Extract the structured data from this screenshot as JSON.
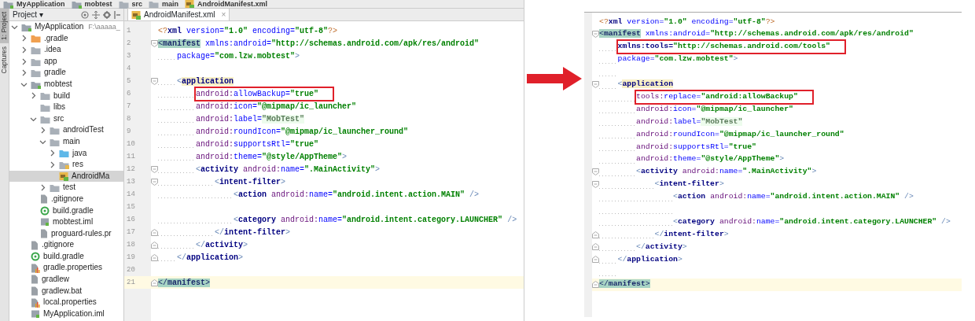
{
  "breadcrumbs": [
    {
      "label": "MyApplication",
      "kind": "module"
    },
    {
      "label": "mobtest",
      "kind": "module"
    },
    {
      "label": "src",
      "kind": "folder"
    },
    {
      "label": "main",
      "kind": "folder"
    },
    {
      "label": "AndroidManifest.xml",
      "kind": "manifest"
    }
  ],
  "tool_strip": [
    {
      "label": "1: Project",
      "selected": true
    },
    {
      "label": "Captures",
      "selected": false
    }
  ],
  "project_panel": {
    "title": "Project ▾",
    "tree": [
      {
        "label": "MyApplication",
        "path": "F:\\aaaaa_",
        "kind": "module",
        "expanded": true,
        "selected": false,
        "children": [
          {
            "label": ".gradle",
            "kind": "excluded",
            "expanded": false,
            "selected": false
          },
          {
            "label": ".idea",
            "kind": "folder",
            "expanded": false,
            "selected": false
          },
          {
            "label": "app",
            "kind": "folder",
            "expanded": false,
            "selected": false
          },
          {
            "label": "gradle",
            "kind": "folder",
            "expanded": false,
            "selected": false
          },
          {
            "label": "mobtest",
            "kind": "module",
            "expanded": true,
            "selected": false,
            "children": [
              {
                "label": "build",
                "kind": "folder",
                "expanded": false,
                "selected": false
              },
              {
                "label": "libs",
                "kind": "folder",
                "selected": false
              },
              {
                "label": "src",
                "kind": "folder",
                "expanded": true,
                "selected": false,
                "children": [
                  {
                    "label": "androidTest",
                    "kind": "folder",
                    "expanded": false,
                    "selected": false
                  },
                  {
                    "label": "main",
                    "kind": "folder",
                    "expanded": true,
                    "selected": false,
                    "children": [
                      {
                        "label": "java",
                        "kind": "source",
                        "expanded": false,
                        "selected": false
                      },
                      {
                        "label": "res",
                        "kind": "resource",
                        "expanded": false,
                        "selected": false
                      },
                      {
                        "label": "AndroidMa",
                        "kind": "manifest",
                        "selected": true
                      }
                    ]
                  },
                  {
                    "label": "test",
                    "kind": "folder",
                    "expanded": false,
                    "selected": false
                  }
                ]
              },
              {
                "label": ".gitignore",
                "kind": "file",
                "selected": false
              },
              {
                "label": "build.gradle",
                "kind": "gradle",
                "selected": false
              },
              {
                "label": "mobtest.iml",
                "kind": "iml",
                "selected": false
              },
              {
                "label": "proguard-rules.pr",
                "kind": "file",
                "selected": false
              }
            ]
          },
          {
            "label": ".gitignore",
            "kind": "file",
            "selected": false
          },
          {
            "label": "build.gradle",
            "kind": "gradle",
            "selected": false
          },
          {
            "label": "gradle.properties",
            "kind": "properties",
            "selected": false
          },
          {
            "label": "gradlew",
            "kind": "file",
            "selected": false
          },
          {
            "label": "gradlew.bat",
            "kind": "file",
            "selected": false
          },
          {
            "label": "local.properties",
            "kind": "properties",
            "selected": false
          },
          {
            "label": "MyApplication.iml",
            "kind": "iml",
            "selected": false
          }
        ]
      }
    ]
  },
  "editor_tab": {
    "label": "AndroidManifest.xml",
    "close": "×",
    "selected": true
  },
  "left_editor": {
    "lines": [
      {
        "number": "1",
        "tokens": [
          {
            "kind": "decl",
            "text": "<?"
          },
          {
            "kind": "tag",
            "text": "xml"
          },
          {
            "kind": "attr",
            "text": " version="
          },
          {
            "kind": "val",
            "text": "\"1.0\""
          },
          {
            "kind": "attr",
            "text": " encoding="
          },
          {
            "kind": "val",
            "text": "\"utf-8\""
          },
          {
            "kind": "decl",
            "text": "?>"
          }
        ]
      },
      {
        "number": "2",
        "fold_start": true,
        "tokens": [
          {
            "kind": "br",
            "text": "<",
            "brace_match": true
          },
          {
            "kind": "tag",
            "text": "manifest",
            "brace_match": true
          },
          {
            "kind": "attr",
            "text": " xmlns:android="
          },
          {
            "kind": "val",
            "text": "\"http://schemas.android.com/apk/res/android\""
          }
        ]
      },
      {
        "number": "3",
        "tokens": [
          {
            "kind": "attr",
            "text": "    package="
          },
          {
            "kind": "val",
            "text": "\"com.lzw.mobtest\""
          },
          {
            "kind": "br",
            "text": ">"
          }
        ]
      },
      {
        "number": "4"
      },
      {
        "number": "5",
        "fold_start": true,
        "tokens": [
          {
            "kind": "br",
            "text": "    <"
          },
          {
            "kind": "tag",
            "text": "application",
            "tag_highlight": true
          }
        ]
      },
      {
        "number": "6",
        "boxed": true,
        "tokens": [
          {
            "kind": "ns",
            "text": "        android:"
          },
          {
            "kind": "attr",
            "text": "allowBackup="
          },
          {
            "kind": "val",
            "text": "\"true\""
          }
        ]
      },
      {
        "number": "7",
        "tokens": [
          {
            "kind": "ns",
            "text": "        android:"
          },
          {
            "kind": "attr",
            "text": "icon="
          },
          {
            "kind": "val",
            "text": "\"@mipmap/ic_launcher\""
          }
        ]
      },
      {
        "number": "8",
        "tokens": [
          {
            "kind": "ns",
            "text": "        android:"
          },
          {
            "kind": "attr",
            "text": "label="
          },
          {
            "kind": "val",
            "text": "\"MobTest\"",
            "string_highlight": true
          }
        ]
      },
      {
        "number": "9",
        "tokens": [
          {
            "kind": "ns",
            "text": "        android:"
          },
          {
            "kind": "attr",
            "text": "roundIcon="
          },
          {
            "kind": "val",
            "text": "\"@mipmap/ic_launcher_round\""
          }
        ]
      },
      {
        "number": "10",
        "tokens": [
          {
            "kind": "ns",
            "text": "        android:"
          },
          {
            "kind": "attr",
            "text": "supportsRtl="
          },
          {
            "kind": "val",
            "text": "\"true\""
          }
        ]
      },
      {
        "number": "11",
        "tokens": [
          {
            "kind": "ns",
            "text": "        android:"
          },
          {
            "kind": "attr",
            "text": "theme="
          },
          {
            "kind": "val",
            "text": "\"@style/AppTheme\""
          },
          {
            "kind": "br",
            "text": ">"
          }
        ]
      },
      {
        "number": "12",
        "fold_start": true,
        "tokens": [
          {
            "kind": "br",
            "text": "        <"
          },
          {
            "kind": "tag",
            "text": "activity"
          },
          {
            "kind": "ns",
            "text": " android:"
          },
          {
            "kind": "attr",
            "text": "name="
          },
          {
            "kind": "val",
            "text": "\".MainActivity\""
          },
          {
            "kind": "br",
            "text": ">"
          }
        ]
      },
      {
        "number": "13",
        "fold_start": true,
        "tokens": [
          {
            "kind": "br",
            "text": "            <"
          },
          {
            "kind": "tag",
            "text": "intent-filter"
          },
          {
            "kind": "br",
            "text": ">"
          }
        ]
      },
      {
        "number": "14",
        "tokens": [
          {
            "kind": "br",
            "text": "                <"
          },
          {
            "kind": "tag",
            "text": "action"
          },
          {
            "kind": "ns",
            "text": " android:"
          },
          {
            "kind": "attr",
            "text": "name="
          },
          {
            "kind": "val",
            "text": "\"android.intent.action.MAIN\""
          },
          {
            "kind": "br",
            "text": " />"
          }
        ]
      },
      {
        "number": "15"
      },
      {
        "number": "16",
        "tokens": [
          {
            "kind": "br",
            "text": "                <"
          },
          {
            "kind": "tag",
            "text": "category"
          },
          {
            "kind": "ns",
            "text": " android:"
          },
          {
            "kind": "attr",
            "text": "name="
          },
          {
            "kind": "val",
            "text": "\"android.intent.category.LAUNCHER\""
          },
          {
            "kind": "br",
            "text": " />"
          }
        ]
      },
      {
        "number": "17",
        "fold_end": true,
        "tokens": [
          {
            "kind": "br",
            "text": "            </"
          },
          {
            "kind": "tag",
            "text": "intent-filter"
          },
          {
            "kind": "br",
            "text": ">"
          }
        ]
      },
      {
        "number": "18",
        "fold_end": true,
        "tokens": [
          {
            "kind": "br",
            "text": "        </"
          },
          {
            "kind": "tag",
            "text": "activity"
          },
          {
            "kind": "br",
            "text": ">"
          }
        ]
      },
      {
        "number": "19",
        "fold_end": true,
        "tokens": [
          {
            "kind": "br",
            "text": "    </"
          },
          {
            "kind": "tag",
            "text": "application"
          },
          {
            "kind": "br",
            "text": ">"
          }
        ]
      },
      {
        "number": "20"
      },
      {
        "number": "21",
        "fold_end": true,
        "current": true,
        "tokens": [
          {
            "kind": "br",
            "text": "</",
            "brace_match": true
          },
          {
            "kind": "tag",
            "text": "manifest",
            "brace_match": true
          },
          {
            "kind": "br",
            "text": ">",
            "brace_match": true
          }
        ]
      }
    ]
  },
  "right_editor": {
    "lines": [
      {
        "tokens": [
          {
            "kind": "decl",
            "text": "<?"
          },
          {
            "kind": "tag",
            "text": "xml"
          },
          {
            "kind": "attr",
            "text": " version="
          },
          {
            "kind": "val",
            "text": "\"1.0\""
          },
          {
            "kind": "attr",
            "text": " encoding="
          },
          {
            "kind": "val",
            "text": "\"utf-8\""
          },
          {
            "kind": "decl",
            "text": "?>"
          }
        ]
      },
      {
        "fold_start": true,
        "tokens": [
          {
            "kind": "br",
            "text": "<",
            "brace_match": true
          },
          {
            "kind": "tag",
            "text": "manifest",
            "brace_match": true
          },
          {
            "kind": "attr",
            "text": " xmlns:android="
          },
          {
            "kind": "val",
            "text": "\"http://schemas.android.com/apk/res/android\""
          }
        ]
      },
      {
        "boxed": true,
        "tokens": [
          {
            "kind": "tag",
            "text": "    xmlns:tools="
          },
          {
            "kind": "val",
            "text": "\"http://schemas.android.com/tools\""
          }
        ]
      },
      {
        "tokens": [
          {
            "kind": "attr",
            "text": "    package="
          },
          {
            "kind": "val",
            "text": "\"com.lzw.mobtest\""
          },
          {
            "kind": "br",
            "text": ">"
          }
        ]
      },
      {
        "fold_start": true,
        "blank_line_before": true,
        "tokens": [
          {
            "kind": "br",
            "text": "    <"
          },
          {
            "kind": "tag",
            "text": "application",
            "tag_highlight": true
          }
        ]
      },
      {
        "boxed": true,
        "tokens": [
          {
            "kind": "ns",
            "text": "        tools:"
          },
          {
            "kind": "attr",
            "text": "replace="
          },
          {
            "kind": "val",
            "text": "\"android:allowBackup\""
          }
        ]
      },
      {
        "tokens": [
          {
            "kind": "ns",
            "text": "        android:"
          },
          {
            "kind": "attr",
            "text": "icon="
          },
          {
            "kind": "val",
            "text": "\"@mipmap/ic_launcher\""
          }
        ]
      },
      {
        "tokens": [
          {
            "kind": "ns",
            "text": "        android:"
          },
          {
            "kind": "attr",
            "text": "label="
          },
          {
            "kind": "val",
            "text": "\"MobTest\"",
            "string_highlight": true
          }
        ]
      },
      {
        "tokens": [
          {
            "kind": "ns",
            "text": "        android:"
          },
          {
            "kind": "attr",
            "text": "roundIcon="
          },
          {
            "kind": "val",
            "text": "\"@mipmap/ic_launcher_round\""
          }
        ]
      },
      {
        "tokens": [
          {
            "kind": "ns",
            "text": "        android:"
          },
          {
            "kind": "attr",
            "text": "supportsRtl="
          },
          {
            "kind": "val",
            "text": "\"true\""
          }
        ]
      },
      {
        "tokens": [
          {
            "kind": "ns",
            "text": "        android:"
          },
          {
            "kind": "attr",
            "text": "theme="
          },
          {
            "kind": "val",
            "text": "\"@style/AppTheme\""
          },
          {
            "kind": "br",
            "text": ">"
          }
        ]
      },
      {
        "fold_start": true,
        "tokens": [
          {
            "kind": "br",
            "text": "        <"
          },
          {
            "kind": "tag",
            "text": "activity"
          },
          {
            "kind": "ns",
            "text": " android:"
          },
          {
            "kind": "attr",
            "text": "name="
          },
          {
            "kind": "val",
            "text": "\".MainActivity\""
          },
          {
            "kind": "br",
            "text": ">"
          }
        ]
      },
      {
        "fold_start": true,
        "tokens": [
          {
            "kind": "br",
            "text": "            <"
          },
          {
            "kind": "tag",
            "text": "intent-filter"
          },
          {
            "kind": "br",
            "text": ">"
          }
        ]
      },
      {
        "tokens": [
          {
            "kind": "br",
            "text": "                <"
          },
          {
            "kind": "tag",
            "text": "action"
          },
          {
            "kind": "ns",
            "text": " android:"
          },
          {
            "kind": "attr",
            "text": "name="
          },
          {
            "kind": "val",
            "text": "\"android.intent.action.MAIN\""
          },
          {
            "kind": "br",
            "text": " />"
          }
        ]
      },
      {
        "blank_line_before": true,
        "tokens": [
          {
            "kind": "br",
            "text": "                <"
          },
          {
            "kind": "tag",
            "text": "category"
          },
          {
            "kind": "ns",
            "text": " android:"
          },
          {
            "kind": "attr",
            "text": "name="
          },
          {
            "kind": "val",
            "text": "\"android.intent.category.LAUNCHER\""
          },
          {
            "kind": "br",
            "text": " />"
          }
        ]
      },
      {
        "fold_end": true,
        "tokens": [
          {
            "kind": "br",
            "text": "            </"
          },
          {
            "kind": "tag",
            "text": "intent-filter"
          },
          {
            "kind": "br",
            "text": ">"
          }
        ]
      },
      {
        "fold_end": true,
        "tokens": [
          {
            "kind": "br",
            "text": "        </"
          },
          {
            "kind": "tag",
            "text": "activity"
          },
          {
            "kind": "br",
            "text": ">"
          }
        ]
      },
      {
        "fold_end": true,
        "tokens": [
          {
            "kind": "br",
            "text": "    </"
          },
          {
            "kind": "tag",
            "text": "application"
          },
          {
            "kind": "br",
            "text": ">"
          }
        ]
      },
      {
        "fold_end": true,
        "current": true,
        "blank_line_before": true,
        "tokens": [
          {
            "kind": "br",
            "text": "</",
            "brace_match": true
          },
          {
            "kind": "tag",
            "text": "manifest",
            "brace_match": true
          },
          {
            "kind": "br",
            "text": ">",
            "brace_match": true
          }
        ]
      }
    ]
  }
}
